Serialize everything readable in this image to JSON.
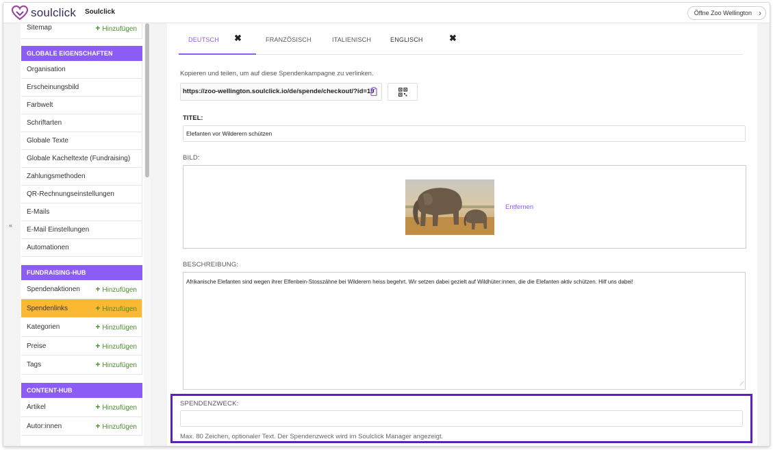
{
  "header": {
    "brand": "soulclick",
    "org_name": "Soulclick",
    "open_button": "Öffne Zoo Wellington"
  },
  "sidebar": {
    "collapse_label": "«",
    "add_label": "Hinzufügen",
    "top_item": "Sitemap",
    "global_header": "GLOBALE EIGENSCHAFTEN",
    "global_items": [
      "Organisation",
      "Erscheinungsbild",
      "Farbwelt",
      "Schriftarten",
      "Globale Texte",
      "Globale Kacheltexte (Fundraising)",
      "Zahlungsmethoden",
      "QR-Rechnungseinstellungen",
      "E-Mails",
      "E-Mail Einstellungen",
      "Automationen"
    ],
    "fundraising_header": "FUNDRAISING-HUB",
    "fundraising_items": [
      "Spendenaktionen",
      "Spendenlinks",
      "Kategorien",
      "Preise",
      "Tags"
    ],
    "content_header": "CONTENT-HUB",
    "content_items": [
      "Artikel",
      "Autor:innen"
    ]
  },
  "tabs": [
    {
      "label": "DEUTSCH",
      "active": true
    },
    {
      "label": "FRANZÖSISCH",
      "active": false
    },
    {
      "label": "ITALIENISCH",
      "active": false
    },
    {
      "label": "ENGLISCH",
      "active": false
    }
  ],
  "tab_close": "✖",
  "share": {
    "hint": "Kopieren und teilen, um auf diese Spendenkampagne zu verlinken.",
    "url": "https://zoo-wellington.soulclick.io/de/spende/checkout/?id=19"
  },
  "form": {
    "title_label": "TITEL:",
    "title_value": "Elefanten vor Wilderern schützen",
    "image_label": "BILD:",
    "remove_label": "Entfernen",
    "description_label": "BESCHREIBUNG:",
    "description_value": "Afrikanische Elefanten sind wegen ihrer Elfenbein-Stosszähne bei Wilderern heiss begehrt. Wir setzen dabei gezielt auf Wildhüter:innen, die die Elefanten aktiv schützen. Hilf uns dabei!",
    "purpose_label": "SPENDENZWECK:",
    "purpose_value": "",
    "purpose_help": "Max. 80 Zeichen, optionaler Text. Der Spendenzweck wird im Soulclick Manager angezeigt."
  },
  "colors": {
    "accent": "#8b5cf6",
    "active_item": "#fcb831",
    "add_green": "#4c8c2e",
    "highlight_frame": "#5b1fbf"
  }
}
